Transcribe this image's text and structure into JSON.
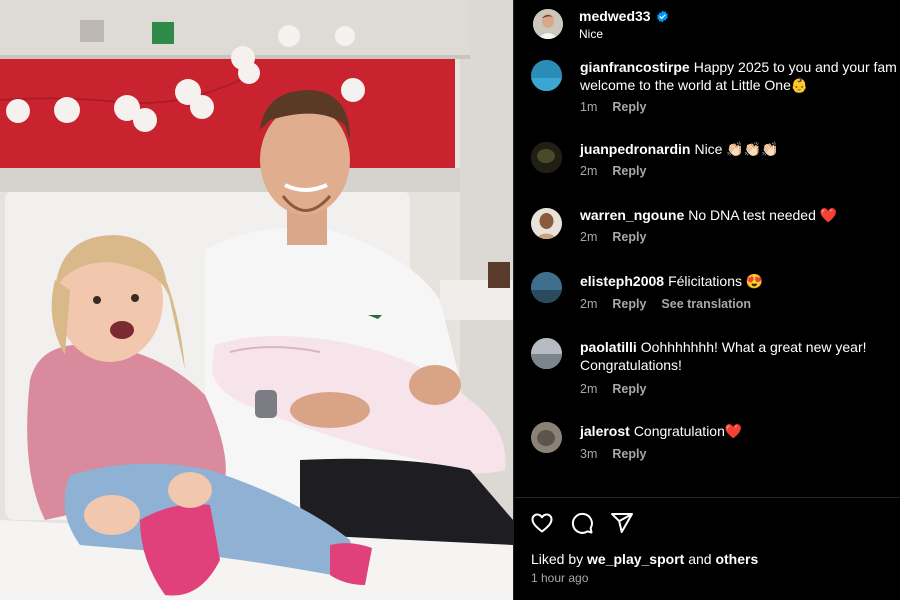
{
  "post": {
    "author": "medwed33",
    "caption": "Nice",
    "verified": true
  },
  "comments": [
    {
      "user": "gianfrancostirpe",
      "text": "Happy 2025 to you and your fam welcome to the world at Little One👶",
      "time": "1m",
      "reply_label": "Reply",
      "avatar_color": "#2b8cb8"
    },
    {
      "user": "juanpedronardin",
      "text": "Nice 👏🏻👏🏻👏🏻",
      "time": "2m",
      "reply_label": "Reply",
      "avatar_color": "#3a3a22"
    },
    {
      "user": "warren_ngoune",
      "text": "No DNA test needed ❤️",
      "time": "2m",
      "reply_label": "Reply",
      "avatar_color": "#c9a27a"
    },
    {
      "user": "elisteph2008",
      "text": "Félicitations 😍",
      "time": "2m",
      "reply_label": "Reply",
      "translate_label": "See translation",
      "avatar_color": "#3f6f8c"
    },
    {
      "user": "paolatilli",
      "text": "Oohhhhhhh! What a great new year! Congratulations!",
      "time": "2m",
      "reply_label": "Reply",
      "avatar_color": "#9aa0a6"
    },
    {
      "user": "jalerost",
      "text": "Congratulation❤️",
      "time": "3m",
      "reply_label": "Reply",
      "avatar_color": "#7d7468"
    }
  ],
  "actions": {
    "like_icon": "heart-icon",
    "comment_icon": "comment-icon",
    "share_icon": "send-icon"
  },
  "likes": {
    "prefix": "Liked by",
    "user": "we_play_sport",
    "joiner": "and",
    "suffix": "others"
  },
  "posted": "1 hour ago",
  "colors": {
    "background": "#000000",
    "text": "#ffffff",
    "muted": "#a8a8a8",
    "verified": "#0095f6",
    "wall_red": "#c8232e"
  }
}
